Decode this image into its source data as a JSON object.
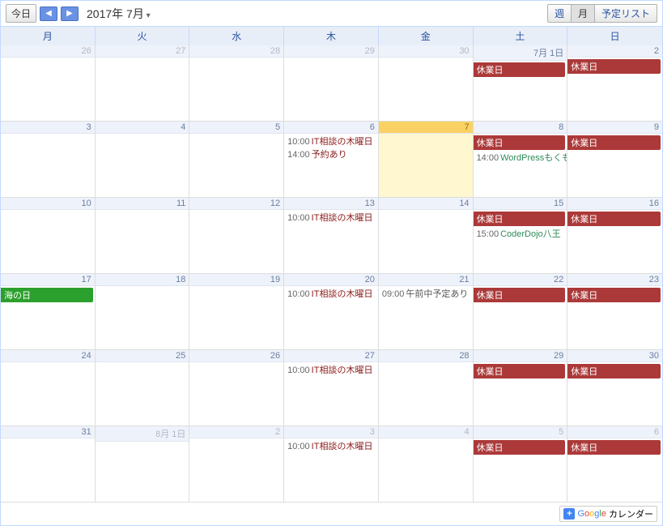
{
  "toolbar": {
    "today_label": "今日",
    "month_title": "2017年 7月",
    "view_week": "週",
    "view_month": "月",
    "view_agenda": "予定リスト"
  },
  "weekdays": [
    "月",
    "火",
    "水",
    "木",
    "金",
    "土",
    "日"
  ],
  "colors": {
    "closed": "#ac3939",
    "holiday": "#2ca02c",
    "it_consult": "#8b1a1a",
    "booked": "#8b1a1a",
    "wp": "#2e8b57",
    "dojo": "#2e8b57",
    "morning": "#555"
  },
  "grid": [
    [
      {
        "num": "26",
        "other": true,
        "events": []
      },
      {
        "num": "27",
        "other": true,
        "events": []
      },
      {
        "num": "28",
        "other": true,
        "events": []
      },
      {
        "num": "29",
        "other": true,
        "events": []
      },
      {
        "num": "30",
        "other": true,
        "events": []
      },
      {
        "num": "7月 1日",
        "events": [
          {
            "type": "bar",
            "label": "休業日",
            "colorKey": "closed"
          }
        ]
      },
      {
        "num": "2",
        "events": [
          {
            "type": "bar",
            "label": "休業日",
            "colorKey": "closed"
          }
        ]
      }
    ],
    [
      {
        "num": "3",
        "events": []
      },
      {
        "num": "4",
        "events": []
      },
      {
        "num": "5",
        "events": []
      },
      {
        "num": "6",
        "events": [
          {
            "type": "timed",
            "time": "10:00",
            "label": "IT相談の木曜日",
            "colorKey": "it_consult"
          },
          {
            "type": "timed",
            "time": "14:00",
            "label": "予約あり",
            "colorKey": "booked"
          }
        ]
      },
      {
        "num": "7",
        "today": true,
        "events": []
      },
      {
        "num": "8",
        "events": [
          {
            "type": "bar",
            "label": "休業日",
            "colorKey": "closed"
          },
          {
            "type": "timed",
            "time": "14:00",
            "label": "WordPressもくも",
            "colorKey": "wp"
          }
        ]
      },
      {
        "num": "9",
        "events": [
          {
            "type": "bar",
            "label": "休業日",
            "colorKey": "closed"
          }
        ]
      }
    ],
    [
      {
        "num": "10",
        "events": []
      },
      {
        "num": "11",
        "events": []
      },
      {
        "num": "12",
        "events": []
      },
      {
        "num": "13",
        "events": [
          {
            "type": "timed",
            "time": "10:00",
            "label": "IT相談の木曜日",
            "colorKey": "it_consult"
          }
        ]
      },
      {
        "num": "14",
        "events": []
      },
      {
        "num": "15",
        "events": [
          {
            "type": "bar",
            "label": "休業日",
            "colorKey": "closed"
          },
          {
            "type": "timed",
            "time": "15:00",
            "label": "CoderDojo八王",
            "colorKey": "dojo"
          }
        ]
      },
      {
        "num": "16",
        "events": [
          {
            "type": "bar",
            "label": "休業日",
            "colorKey": "closed"
          }
        ]
      }
    ],
    [
      {
        "num": "17",
        "events": [
          {
            "type": "bar",
            "label": "海の日",
            "colorKey": "holiday"
          }
        ]
      },
      {
        "num": "18",
        "events": []
      },
      {
        "num": "19",
        "events": []
      },
      {
        "num": "20",
        "events": [
          {
            "type": "timed",
            "time": "10:00",
            "label": "IT相談の木曜日",
            "colorKey": "it_consult"
          }
        ]
      },
      {
        "num": "21",
        "events": [
          {
            "type": "timed",
            "time": "09:00",
            "label": "午前中予定あり",
            "colorKey": "morning"
          }
        ]
      },
      {
        "num": "22",
        "events": [
          {
            "type": "bar",
            "label": "休業日",
            "colorKey": "closed"
          }
        ]
      },
      {
        "num": "23",
        "events": [
          {
            "type": "bar",
            "label": "休業日",
            "colorKey": "closed"
          }
        ]
      }
    ],
    [
      {
        "num": "24",
        "events": []
      },
      {
        "num": "25",
        "events": []
      },
      {
        "num": "26",
        "events": []
      },
      {
        "num": "27",
        "events": [
          {
            "type": "timed",
            "time": "10:00",
            "label": "IT相談の木曜日",
            "colorKey": "it_consult"
          }
        ]
      },
      {
        "num": "28",
        "events": []
      },
      {
        "num": "29",
        "events": [
          {
            "type": "bar",
            "label": "休業日",
            "colorKey": "closed"
          }
        ]
      },
      {
        "num": "30",
        "events": [
          {
            "type": "bar",
            "label": "休業日",
            "colorKey": "closed"
          }
        ]
      }
    ],
    [
      {
        "num": "31",
        "events": []
      },
      {
        "num": "8月 1日",
        "other": true,
        "events": []
      },
      {
        "num": "2",
        "other": true,
        "events": []
      },
      {
        "num": "3",
        "other": true,
        "events": [
          {
            "type": "timed",
            "time": "10:00",
            "label": "IT相談の木曜日",
            "colorKey": "it_consult"
          }
        ]
      },
      {
        "num": "4",
        "other": true,
        "events": []
      },
      {
        "num": "5",
        "other": true,
        "events": [
          {
            "type": "bar",
            "label": "休業日",
            "colorKey": "closed"
          }
        ]
      },
      {
        "num": "6",
        "other": true,
        "events": [
          {
            "type": "bar",
            "label": "休業日",
            "colorKey": "closed"
          }
        ]
      }
    ]
  ],
  "footer": {
    "brand_suffix": "カレンダー"
  }
}
